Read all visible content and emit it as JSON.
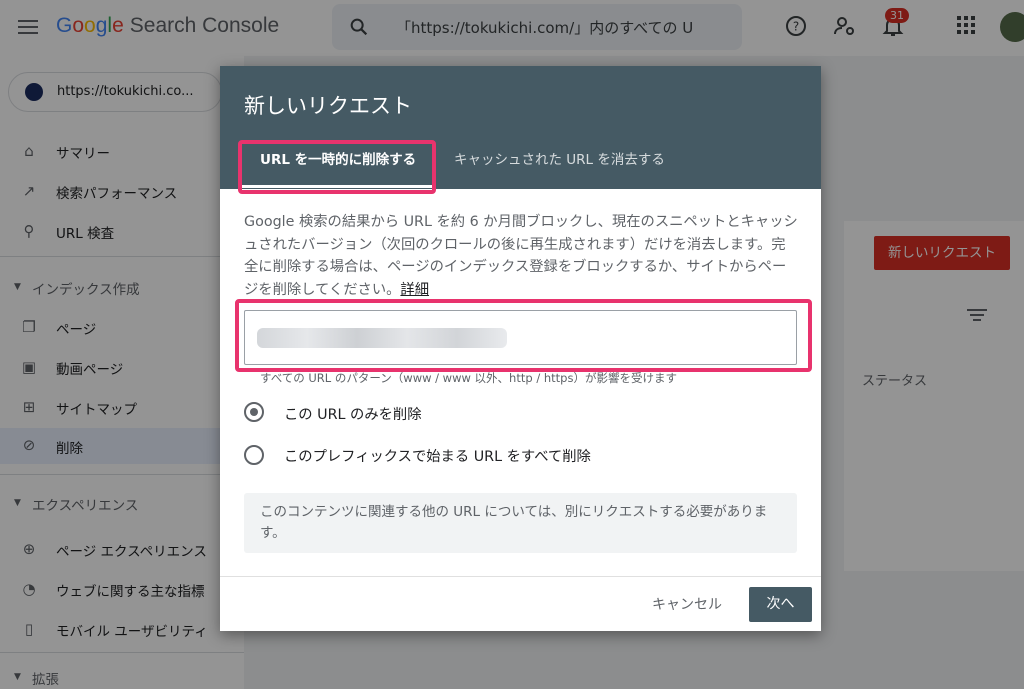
{
  "header": {
    "logo_parts": [
      "G",
      "o",
      "o",
      "g",
      "l",
      "e"
    ],
    "product_name": "Search Console",
    "search_value": "「https://tokukichi.com/」内のすべての U",
    "notification_count": "31"
  },
  "sidebar": {
    "property": "https://tokukichi.co...",
    "items": [
      {
        "label": "サマリー",
        "icon": "home-icon"
      },
      {
        "label": "検索パフォーマンス",
        "icon": "trending-up-icon"
      },
      {
        "label": "URL 検査",
        "icon": "search-icon"
      }
    ],
    "section_index": "インデックス作成",
    "index_items": [
      {
        "label": "ページ",
        "icon": "pages-icon"
      },
      {
        "label": "動画ページ",
        "icon": "video-page-icon"
      },
      {
        "label": "サイトマップ",
        "icon": "sitemap-icon"
      },
      {
        "label": "削除",
        "icon": "eye-off-icon"
      }
    ],
    "section_experience": "エクスペリエンス",
    "experience_items": [
      {
        "label": "ページ エクスペリエンス",
        "icon": "plus-circle-icon"
      },
      {
        "label": "ウェブに関する主な指標",
        "icon": "gauge-icon"
      },
      {
        "label": "モバイル ユーザビリティ",
        "icon": "phone-icon"
      }
    ],
    "section_extensions": "拡張"
  },
  "main": {
    "new_request_button": "新しいリクエスト",
    "status_column": "ステータス"
  },
  "dialog": {
    "title": "新しいリクエスト",
    "tabs": [
      {
        "label": "URL を一時的に削除する",
        "selected": true
      },
      {
        "label": "キャッシュされた URL を消去する",
        "selected": false
      }
    ],
    "description": "Google 検索の結果から URL を約 6 か月間ブロックし、現在のスニペットとキャッシュされたバージョン（次回のクロールの後に再生成されます）だけを消去します。完全に削除する場合は、ページのインデックス登録をブロックするか、サイトからページを削除してください。",
    "details_link": "詳細",
    "url_hint": "すべての URL のパターン（www / www 以外、http / https）が影響を受けます",
    "options": [
      {
        "label": "この URL のみを削除",
        "checked": true
      },
      {
        "label": "このプレフィックスで始まる URL をすべて削除",
        "checked": false
      }
    ],
    "note": "このコンテンツに関連する他の URL については、別にリクエストする必要があります。",
    "cancel_label": "キャンセル",
    "next_label": "次へ"
  },
  "colors": {
    "dialog_header": "#455a64",
    "highlight": "#e8336d",
    "danger_button": "#d93025"
  }
}
